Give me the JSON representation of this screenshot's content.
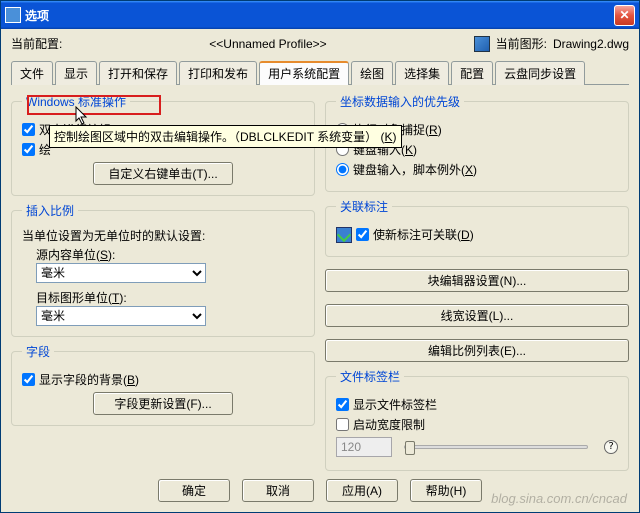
{
  "titlebar": {
    "title": "选项"
  },
  "top": {
    "current_profile_label": "当前配置:",
    "profile_name": "<<Unnamed Profile>>",
    "current_drawing_label": "当前图形:",
    "drawing_name": "Drawing2.dwg"
  },
  "tabs": {
    "items": [
      "文件",
      "显示",
      "打开和保存",
      "打印和发布",
      "用户系统配置",
      "绘图",
      "选择集",
      "配置",
      "云盘同步设置"
    ],
    "active_index": 4
  },
  "left": {
    "group_std": "Windows 标准操作",
    "cb_dblclk_edit": "双击进行编辑",
    "cb_dblclk_edit_key": "O",
    "cb_draw": "绘",
    "tooltip": "控制绘图区域中的双击编辑操作。（DBLCLKEDIT 系统变量）",
    "tooltip_key": "K",
    "btn_rclick": "自定义右键单击(T)...",
    "group_scale": "插入比例",
    "scale_desc": "当单位设置为无单位时的默认设置:",
    "src_unit_label": "源内容单位",
    "src_unit_key": "S",
    "src_unit_val": "毫米",
    "tgt_unit_label": "目标图形单位",
    "tgt_unit_key": "T",
    "tgt_unit_val": "毫米",
    "group_field": "字段",
    "cb_field_bg": "显示字段的背景",
    "cb_field_bg_key": "B",
    "btn_field": "字段更新设置(F)..."
  },
  "right": {
    "group_priority": "坐标数据输入的优先级",
    "rb_osnap": "执行对象捕捉",
    "rb_osnap_key": "R",
    "rb_kbd": "键盘输入",
    "rb_kbd_key": "K",
    "rb_kbd_except": "键盘输入，脚本例外",
    "rb_kbd_except_key": "X",
    "group_assoc": "关联标注",
    "cb_assoc": "使新标注可关联",
    "cb_assoc_key": "D",
    "btn_blockeditor": "块编辑器设置(N)...",
    "btn_lineweight": "线宽设置(L)...",
    "btn_editscale": "编辑比例列表(E)...",
    "group_filetab": "文件标签栏",
    "cb_showtabs": "显示文件标签栏",
    "cb_widthlimit": "启动宽度限制",
    "width_value": "120"
  },
  "footer": {
    "ok": "确定",
    "cancel": "取消",
    "apply": "应用(A)",
    "help": "帮助(H)"
  },
  "watermark": "blog.sina.com.cn/cncad"
}
